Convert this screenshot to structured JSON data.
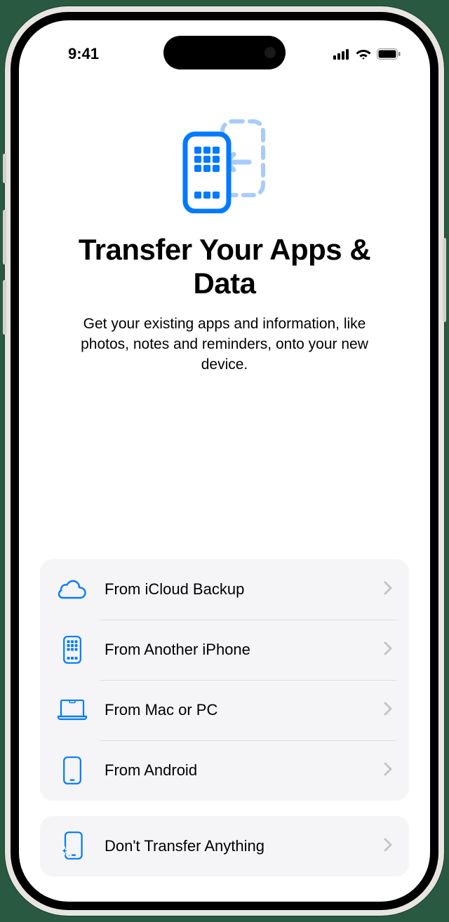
{
  "status_bar": {
    "time": "9:41"
  },
  "header": {
    "title": "Transfer Your Apps & Data",
    "subtitle": "Get your existing apps and information, like photos, notes and reminders, onto your new device."
  },
  "options": {
    "group_main": [
      {
        "label": "From iCloud Backup",
        "icon": "cloud"
      },
      {
        "label": "From Another iPhone",
        "icon": "iphone-grid"
      },
      {
        "label": "From Mac or PC",
        "icon": "laptop"
      },
      {
        "label": "From Android",
        "icon": "phone"
      }
    ],
    "group_alt": [
      {
        "label": "Don't Transfer Anything",
        "icon": "phone-sparkle"
      }
    ]
  },
  "colors": {
    "accent": "#007AFF",
    "accent_light": "#A8CCFA",
    "text": "#000000",
    "card_bg": "#F5F5F7",
    "chevron": "#C4C4C8"
  }
}
